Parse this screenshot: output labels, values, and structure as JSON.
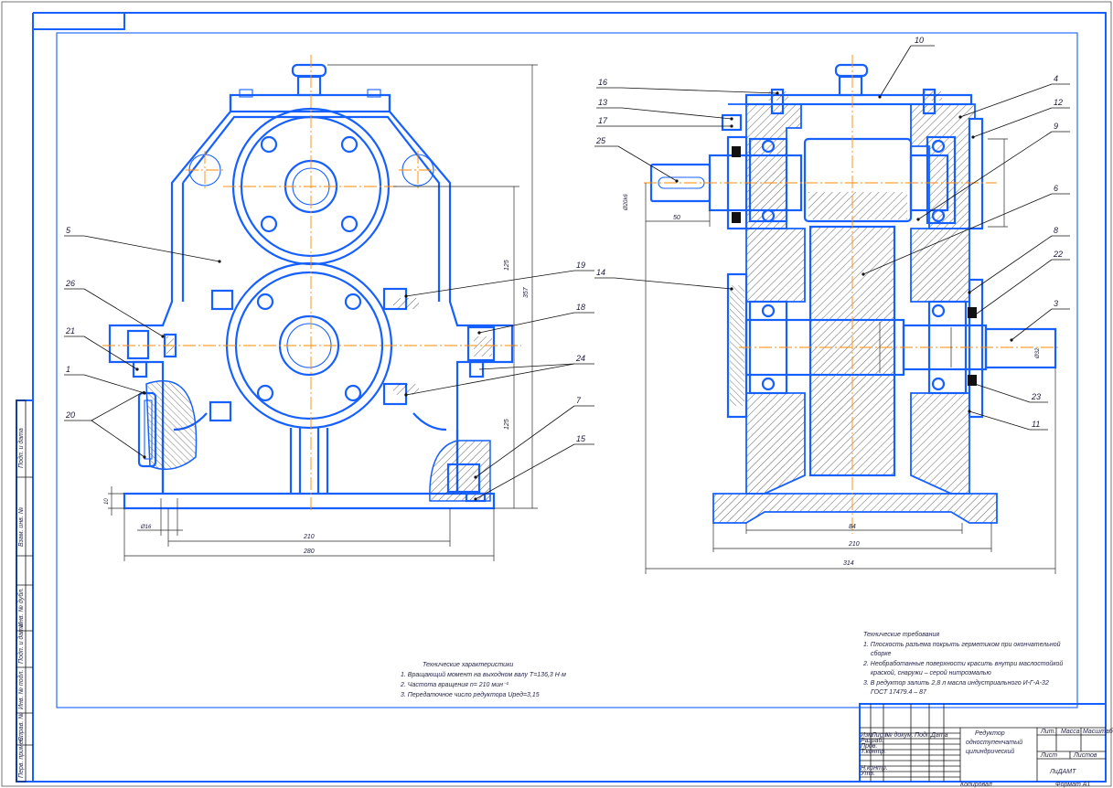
{
  "colors": {
    "part": "#1560ff",
    "axis": "#ff8a00",
    "ink": "#111111"
  },
  "side_strip": [
    "Подп. и дата",
    "Взам. инв. №",
    "Инв. № дубл.",
    "Подп. и дата",
    "Инв. № подл.",
    "Справ. №",
    "Перв. примен."
  ],
  "callouts": {
    "c10": "10",
    "c16": "16",
    "c13": "13",
    "c17": "17",
    "c25": "25",
    "c4": "4",
    "c12": "12",
    "c9": "9",
    "c6": "6",
    "c8": "8",
    "c22": "22",
    "c3": "3",
    "c23": "23",
    "c11": "11",
    "c14": "14",
    "c5": "5",
    "c26": "26",
    "c21": "21",
    "c1": "1",
    "c20": "20",
    "c19": "19",
    "c18": "18",
    "c24": "24",
    "c7": "7",
    "c15": "15"
  },
  "dims": {
    "d210a": "210",
    "d280": "280",
    "d16": "Ø16",
    "d10": "10",
    "d125a": "125",
    "d125b": "125",
    "d357": "357",
    "d50": "50",
    "d84": "84",
    "d210b": "210",
    "d314": "314",
    "dshaft_in": "Ø20k6",
    "dshaft_out": "Ø32"
  },
  "tech_specs": {
    "title": "Технические характеристики",
    "l1": "1. Вращающий момент на выходном валу T=136,3 Н·м",
    "l2": "2. Частота вращения n= 210 мин⁻¹",
    "l3": "3. Передаточное число редуктора Uред=3,15"
  },
  "tech_req": {
    "title": "Технические требования",
    "l1": "1. Плоскость разъема покрыть герметиком при окончательной",
    "l1b": "сборке",
    "l2": "2. Необработанные поверхности красить внутри маслостойкой",
    "l2b": "краской, снаружи – серой нитроэмалью",
    "l3": "3. В редуктор залить 2,8 л масла индустриального И-Г-А-32",
    "l3b": "ГОСТ 17479.4 – 87"
  },
  "title_block": {
    "name1": "Редуктор",
    "name2": "одноступенчатый",
    "name3": "цилиндрический",
    "org": "ЛиДАМТ",
    "h_lit": "Лит.",
    "h_mass": "Масса",
    "h_scale": "Масштаб",
    "sheet": "Лист",
    "sheets": "Листов",
    "copied": "Копировал",
    "format": "Формат А1",
    "rows": [
      "Изм.",
      "Лист",
      "№ докум.",
      "Подп.",
      "Дата"
    ],
    "roles": [
      "Разраб.",
      "Пров.",
      "Т.контр.",
      "Н.контр.",
      "Утв."
    ]
  }
}
